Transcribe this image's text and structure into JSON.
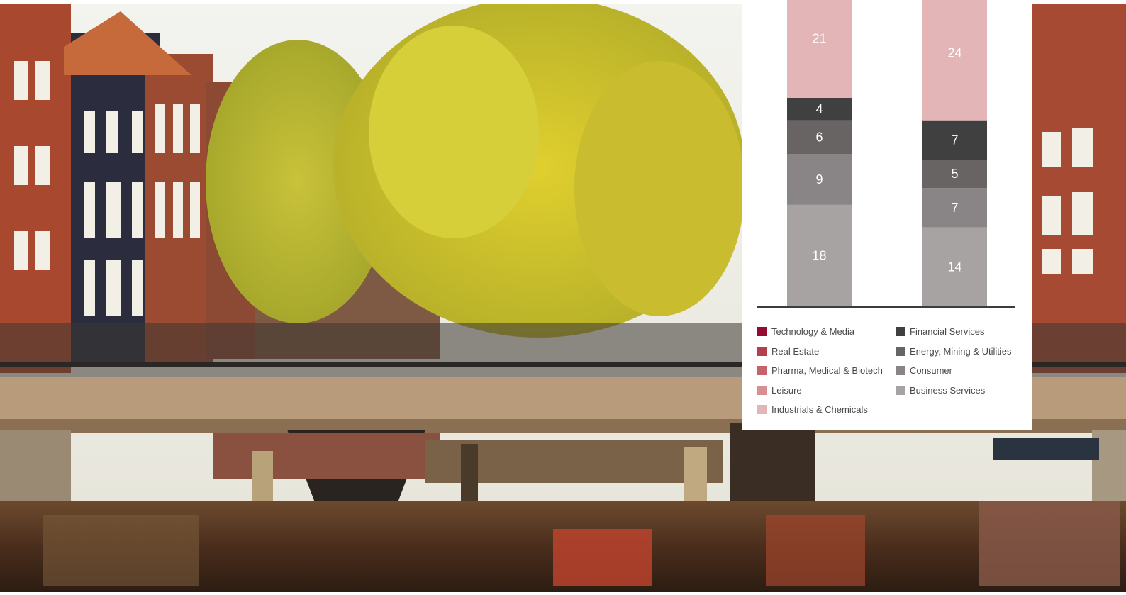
{
  "chart_data": {
    "type": "bar",
    "stacked": true,
    "categories": [
      "",
      ""
    ],
    "series": [
      {
        "name": "Business Services",
        "values": [
          18,
          14
        ],
        "color": "#a7a3a3"
      },
      {
        "name": "Consumer",
        "values": [
          9,
          7
        ],
        "color": "#898586"
      },
      {
        "name": "Energy, Mining & Utilities",
        "values": [
          6,
          5
        ],
        "color": "#686464"
      },
      {
        "name": "Financial Services",
        "values": [
          4,
          7
        ],
        "color": "#404040"
      },
      {
        "name": "Industrials & Chemicals",
        "values": [
          21,
          24
        ],
        "color": "#e3b5b6"
      },
      {
        "name": "Leisure",
        "values": [
          null,
          null
        ],
        "color": "#d88f93"
      },
      {
        "name": "Pharma, Medical & Biotech",
        "values": [
          null,
          null
        ],
        "color": "#c4636a"
      },
      {
        "name": "Real Estate",
        "values": [
          null,
          null
        ],
        "color": "#b2404b"
      },
      {
        "name": "Technology & Media",
        "values": [
          null,
          null
        ],
        "color": "#960a32"
      }
    ],
    "legend_position": "bottom",
    "grid": false,
    "xlabel": "",
    "ylabel": ""
  },
  "legend": {
    "left": [
      {
        "label": "Technology & Media",
        "color": "#960a32"
      },
      {
        "label": "Real Estate",
        "color": "#b2404b"
      },
      {
        "label": "Pharma, Medical & Biotech",
        "color": "#c4636a"
      },
      {
        "label": "Leisure",
        "color": "#d88f93"
      },
      {
        "label": "Industrials & Chemicals",
        "color": "#e3b5b6"
      }
    ],
    "right": [
      {
        "label": "Financial Services",
        "color": "#404040"
      },
      {
        "label": "Energy, Mining & Utilities",
        "color": "#686464"
      },
      {
        "label": "Consumer",
        "color": "#898586"
      },
      {
        "label": "Business Services",
        "color": "#a7a3a3"
      }
    ]
  }
}
